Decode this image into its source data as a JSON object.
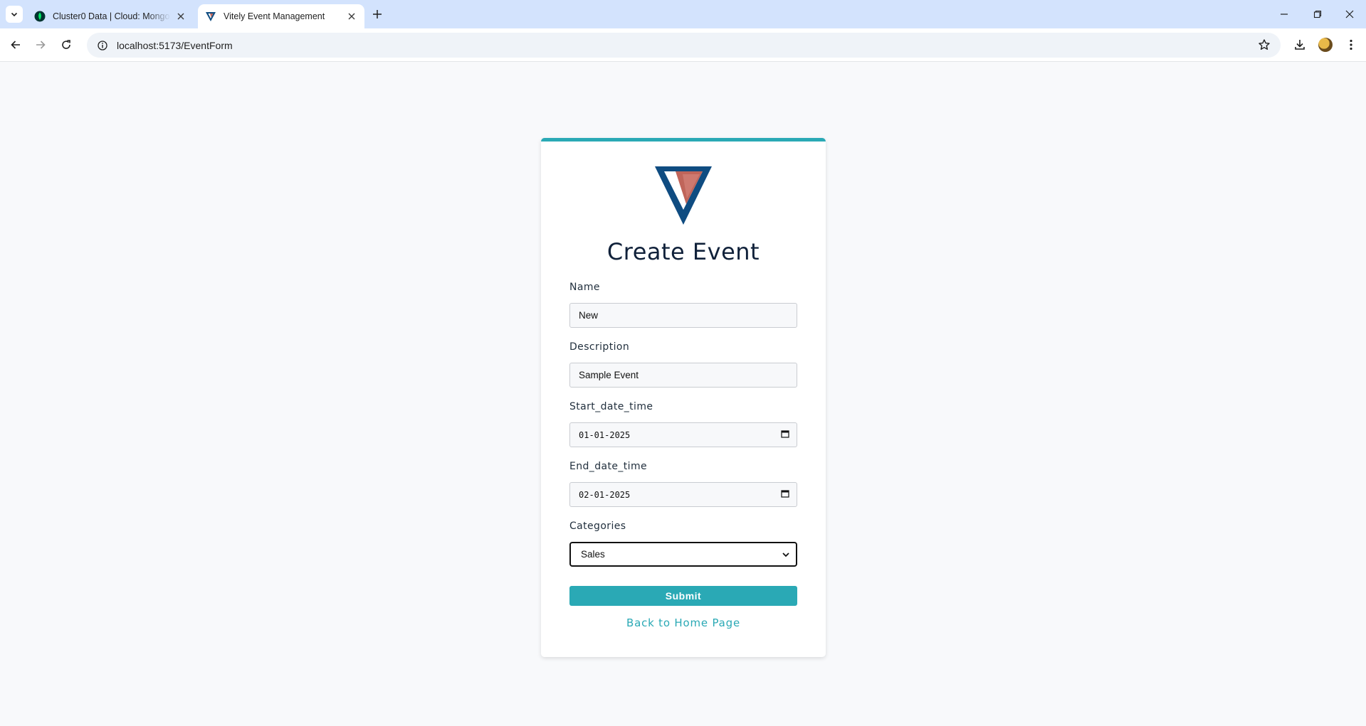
{
  "browser": {
    "tabs": [
      {
        "title": "Cluster0 Data | Cloud: MongoDB Cloud",
        "active": false,
        "icon": "mongodb-leaf-icon"
      },
      {
        "title": "Vitely Event Management",
        "active": true,
        "icon": "vitely-logo-icon"
      }
    ],
    "url": "localhost:5173/EventForm"
  },
  "form": {
    "title": "Create Event",
    "fields": {
      "name": {
        "label": "Name",
        "value": "New"
      },
      "description": {
        "label": "Description",
        "value": "Sample Event"
      },
      "start": {
        "label": "Start_date_time",
        "value": "01-01-2025"
      },
      "end": {
        "label": "End_date_time",
        "value": "02-01-2025"
      },
      "categories": {
        "label": "Categories",
        "value": "Sales"
      }
    },
    "submit_label": "Submit",
    "back_link": "Back to Home Page"
  },
  "colors": {
    "accent": "#2aa9b5",
    "logo_blue": "#0f4c81",
    "logo_red": "#c0655a",
    "tabstrip": "#d3e3fd",
    "page_bg": "#f8f9fb"
  }
}
